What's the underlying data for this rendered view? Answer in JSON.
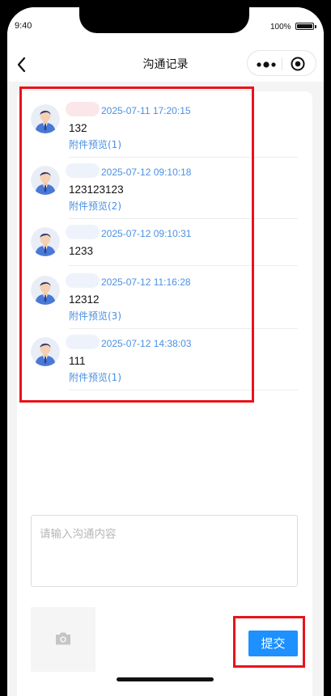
{
  "status_bar": {
    "time": "9:40",
    "battery": "100%"
  },
  "nav": {
    "title": "沟通记录",
    "back_icon": "chevron-left-icon",
    "more_icon": "more-dots-icon",
    "close_icon": "target-circle-icon"
  },
  "records": [
    {
      "time": "2025-07-11 17:20:15",
      "content": "132",
      "attachment": "附件预览(1)"
    },
    {
      "time": "2025-07-12 09:10:18",
      "content": "123123123",
      "attachment": "附件预览(2)"
    },
    {
      "time": "2025-07-12 09:10:31",
      "content": "1233",
      "attachment": ""
    },
    {
      "time": "2025-07-12 11:16:28",
      "content": "12312",
      "attachment": "附件预览(3)"
    },
    {
      "time": "2025-07-12 14:38:03",
      "content": "111",
      "attachment": "附件预览(1)"
    }
  ],
  "form": {
    "placeholder": "请输入沟通内容",
    "upload_icon": "camera-icon",
    "submit_label": "提交"
  },
  "colors": {
    "accent": "#1e90ff",
    "link": "#4a90e2",
    "highlight": "#e8131b"
  }
}
